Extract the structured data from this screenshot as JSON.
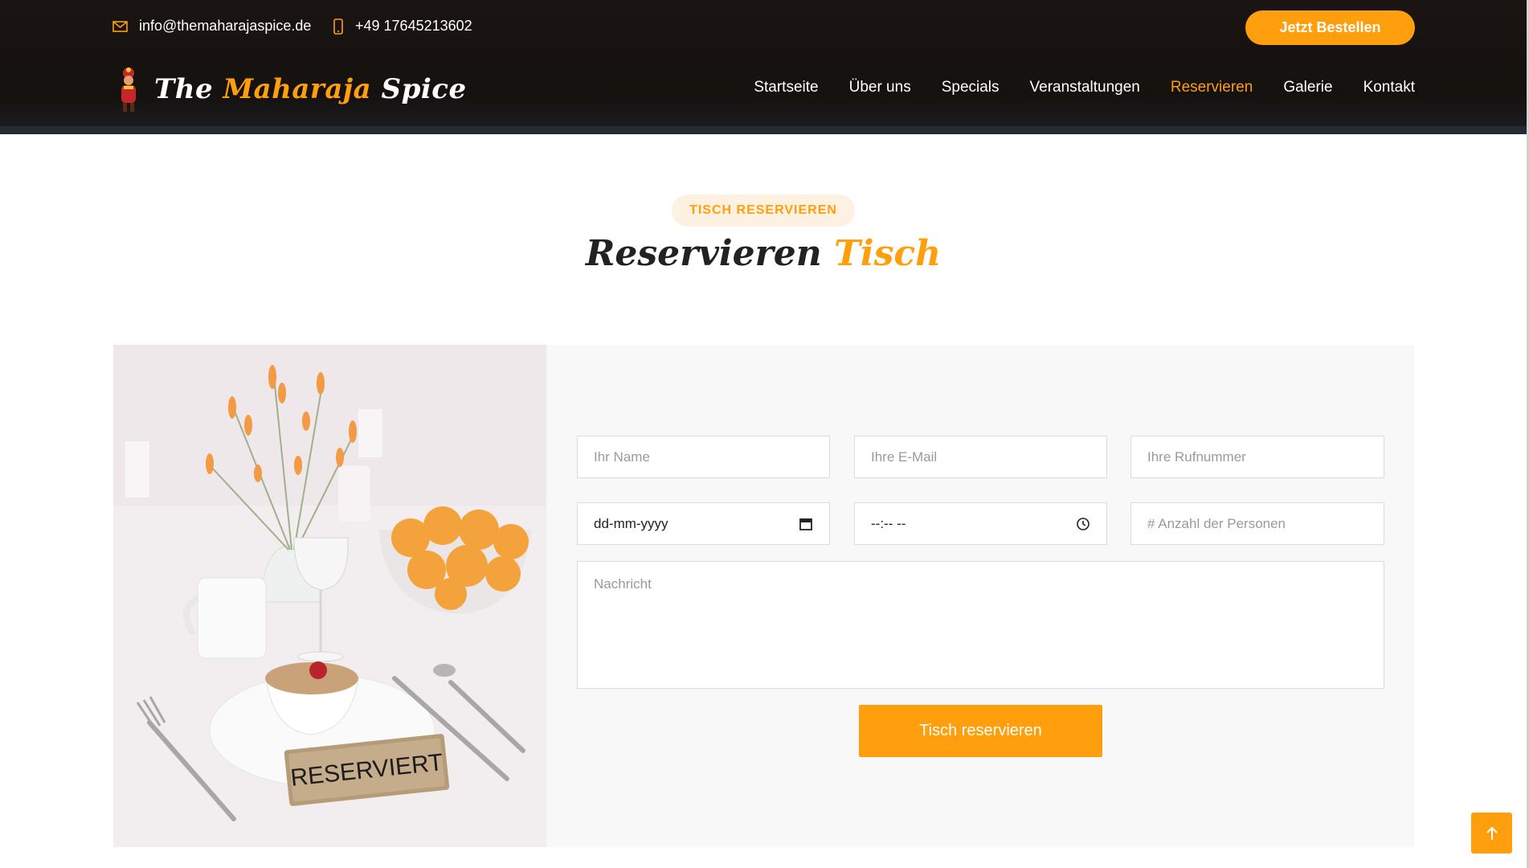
{
  "topbar": {
    "email": "info@themaharajaspice.de",
    "email_icon": "envelope-icon",
    "phone": "+49 17645213602",
    "phone_icon": "mobile-phone-icon",
    "order_button": "Jetzt Bestellen"
  },
  "logo": {
    "prefix": "The ",
    "highlight": "Maharaja",
    "suffix": " Spice",
    "mascot_icon": "maharaja-mascot-icon"
  },
  "nav": {
    "items": [
      {
        "label": "Startseite"
      },
      {
        "label": "Über uns"
      },
      {
        "label": "Specials"
      },
      {
        "label": "Veranstaltungen"
      },
      {
        "label": "Reservieren",
        "active": true
      },
      {
        "label": "Galerie"
      },
      {
        "label": "Kontakt"
      }
    ]
  },
  "section": {
    "badge": "TISCH RESERVIEREN",
    "title_main": "Reservieren",
    "title_highlight": "Tisch"
  },
  "photo": {
    "sign_text": "RESERVIERT"
  },
  "form": {
    "name_placeholder": "Ihr Name",
    "email_placeholder": "Ihre E-Mail",
    "phone_placeholder": "Ihre Rufnummer",
    "date_value": "dd-mm-yyyy",
    "time_value": "--:-- --",
    "persons_placeholder": "# Anzahl der Personen",
    "message_placeholder": "Nachricht",
    "submit_label": "Tisch reservieren"
  },
  "colors": {
    "accent": "#ff9f0d",
    "header_bg": "#15110f",
    "panel_bg": "#f8f8f8"
  }
}
